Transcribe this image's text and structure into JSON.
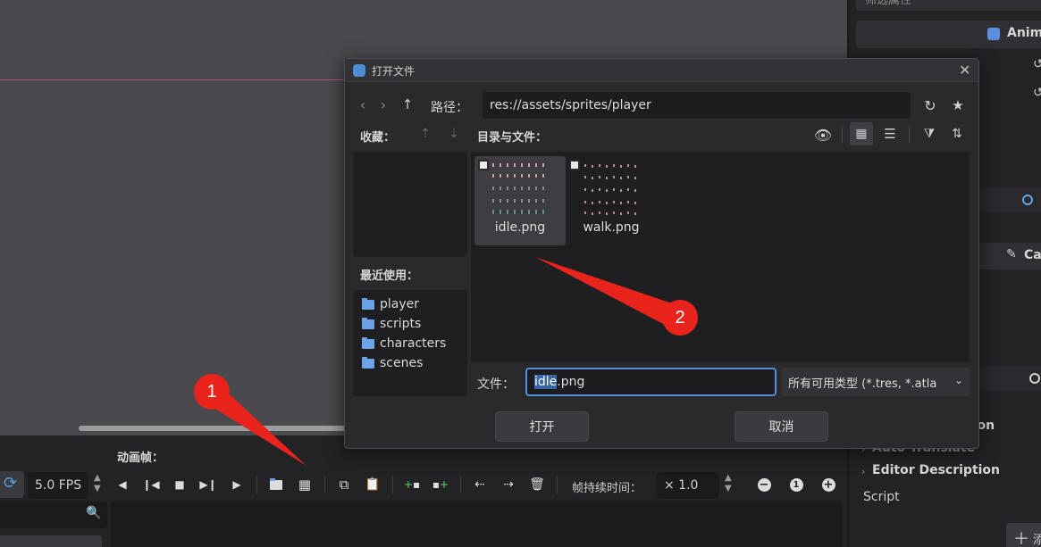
{
  "inspector": {
    "filter_placeholder": "筛选属性",
    "animation_label": "Anima",
    "c_label": "Ca",
    "auto_translate": "Auto Translate",
    "partial_option": "tion",
    "editor_description": "Editor Description",
    "script": "Script",
    "add_label": "添"
  },
  "bottom": {
    "title": "动画帧：",
    "fps": "5.0 FPS",
    "duration_label": "帧持续时间：",
    "duration_value": "× 1.0"
  },
  "dialog": {
    "title": "打开文件",
    "path_label": "路径：",
    "path_value": "res://assets/sprites/player",
    "favorites_label": "收藏：",
    "dirs_files_label": "目录与文件：",
    "recent_label": "最近使用：",
    "recent_items": [
      "player",
      "scripts",
      "characters",
      "scenes"
    ],
    "files": [
      "idle.png",
      "walk.png"
    ],
    "file_label": "文件：",
    "file_name": "idle.png",
    "file_name_selected": "idle",
    "file_name_rest": ".png",
    "filter_value": "所有可用类型 (*.tres, *.atla",
    "open_button": "打开",
    "cancel_button": "取消"
  },
  "annotations": [
    "1",
    "2"
  ],
  "colors": {
    "accent_blue": "#6aa3e8",
    "annotation_red": "#e8241d",
    "guide_pink": "#a8558f",
    "add_green": "#62d26e"
  }
}
